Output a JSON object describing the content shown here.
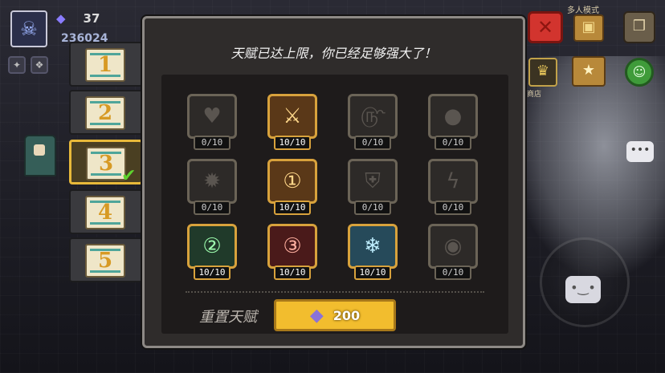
{
  "hud": {
    "gem_value": "37",
    "coin_value": "236024",
    "mode_label": "多人模式",
    "store_label": "商店",
    "icons": [
      "avatar-icon",
      "gem-icon",
      "close-icon",
      "chest-icon",
      "pack-icon",
      "crown-icon",
      "shop-icon",
      "chat-icon",
      "bubble-icon"
    ]
  },
  "tabs": [
    {
      "label": "1",
      "active": false
    },
    {
      "label": "2",
      "active": false
    },
    {
      "label": "3",
      "active": true,
      "completed": true
    },
    {
      "label": "4",
      "active": false
    },
    {
      "label": "5",
      "active": false
    }
  ],
  "panel": {
    "title": "天赋已达上限，你已经足够强大了！",
    "talents": [
      {
        "level": "0/10",
        "icon": "heart-icon",
        "learned": false
      },
      {
        "level": "10/10",
        "icon": "sword-icon",
        "learned": true,
        "tone": "gold"
      },
      {
        "level": "0/10",
        "icon": "swirl-icon",
        "learned": false
      },
      {
        "level": "0/10",
        "icon": "drop-icon",
        "learned": false
      },
      {
        "level": "0/10",
        "icon": "bomb-icon",
        "learned": false
      },
      {
        "level": "10/10",
        "icon": "weapon-1-icon",
        "learned": true,
        "tone": "gold"
      },
      {
        "level": "0/10",
        "icon": "shield-icon",
        "learned": false
      },
      {
        "level": "0/10",
        "icon": "lightning-icon",
        "learned": false
      },
      {
        "level": "10/10",
        "icon": "weapon-2-icon",
        "learned": true,
        "tone": "green"
      },
      {
        "level": "10/10",
        "icon": "weapon-3-icon",
        "learned": true,
        "tone": "red"
      },
      {
        "level": "10/10",
        "icon": "snowflake-icon",
        "learned": true,
        "tone": "blue"
      },
      {
        "level": "0/10",
        "icon": "cyclops-icon",
        "learned": false
      }
    ],
    "reset_label": "重置天赋",
    "reset_cost": "200",
    "reset_currency_icon": "diamond-icon"
  }
}
